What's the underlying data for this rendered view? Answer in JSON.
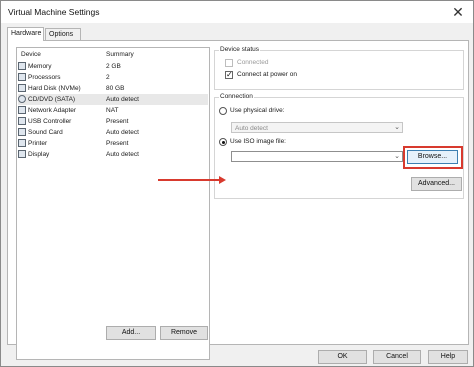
{
  "window": {
    "title": "Virtual Machine Settings",
    "close_glyph": "✕"
  },
  "tabs": [
    {
      "label": "Hardware"
    },
    {
      "label": "Options"
    }
  ],
  "device_list": {
    "header_device": "Device",
    "header_summary": "Summary",
    "items": [
      {
        "name": "Memory",
        "summary": "2 GB",
        "icon": "memory-icon"
      },
      {
        "name": "Processors",
        "summary": "2",
        "icon": "processor-icon"
      },
      {
        "name": "Hard Disk (NVMe)",
        "summary": "80 GB",
        "icon": "hard-disk-icon"
      },
      {
        "name": "CD/DVD (SATA)",
        "summary": "Auto detect",
        "icon": "cd-dvd-icon",
        "selected": true
      },
      {
        "name": "Network Adapter",
        "summary": "NAT",
        "icon": "network-adapter-icon"
      },
      {
        "name": "USB Controller",
        "summary": "Present",
        "icon": "usb-controller-icon"
      },
      {
        "name": "Sound Card",
        "summary": "Auto detect",
        "icon": "sound-card-icon"
      },
      {
        "name": "Printer",
        "summary": "Present",
        "icon": "printer-icon"
      },
      {
        "name": "Display",
        "summary": "Auto detect",
        "icon": "display-icon"
      }
    ]
  },
  "buttons": {
    "add": "Add...",
    "remove": "Remove",
    "browse": "Browse...",
    "advanced": "Advanced...",
    "ok": "OK",
    "cancel": "Cancel",
    "help": "Help"
  },
  "device_status": {
    "title": "Device status",
    "connected_label": "Connected",
    "connected_checked": false,
    "connect_at_power_on_label": "Connect at power on",
    "connect_at_power_on_checked": true
  },
  "connection": {
    "title": "Connection",
    "use_physical_drive_label": "Use physical drive:",
    "physical_drive_value": "Auto detect",
    "use_iso_label": "Use ISO image file:",
    "iso_path_value": "",
    "selected_option": "iso"
  },
  "colors": {
    "annotation": "#d83a2e",
    "browse_border": "#3c7fb1"
  }
}
